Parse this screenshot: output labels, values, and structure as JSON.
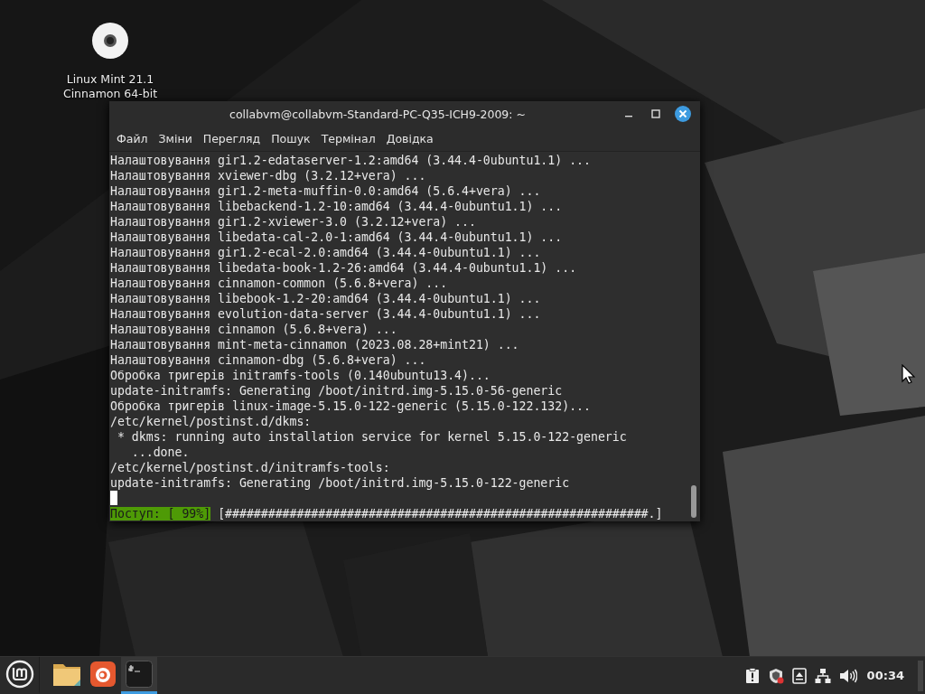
{
  "desktop": {
    "icons": [
      {
        "kind": "disc",
        "label": "Linux Mint 21.1 Cinnamon 64-bit"
      }
    ]
  },
  "window": {
    "title": "collabvm@collabvm-Standard-PC-Q35-ICH9-2009: ~",
    "menu": [
      "Файл",
      "Зміни",
      "Перегляд",
      "Пошук",
      "Термінал",
      "Довідка"
    ],
    "terminal": {
      "lines": [
        "Налаштовування gir1.2-edataserver-1.2:amd64 (3.44.4-0ubuntu1.1) ...",
        "Налаштовування xviewer-dbg (3.2.12+vera) ...",
        "Налаштовування gir1.2-meta-muffin-0.0:amd64 (5.6.4+vera) ...",
        "Налаштовування libebackend-1.2-10:amd64 (3.44.4-0ubuntu1.1) ...",
        "Налаштовування gir1.2-xviewer-3.0 (3.2.12+vera) ...",
        "Налаштовування libedata-cal-2.0-1:amd64 (3.44.4-0ubuntu1.1) ...",
        "Налаштовування gir1.2-ecal-2.0:amd64 (3.44.4-0ubuntu1.1) ...",
        "Налаштовування libedata-book-1.2-26:amd64 (3.44.4-0ubuntu1.1) ...",
        "Налаштовування cinnamon-common (5.6.8+vera) ...",
        "Налаштовування libebook-1.2-20:amd64 (3.44.4-0ubuntu1.1) ...",
        "Налаштовування evolution-data-server (3.44.4-0ubuntu1.1) ...",
        "Налаштовування cinnamon (5.6.8+vera) ...",
        "Налаштовування mint-meta-cinnamon (2023.08.28+mint21) ...",
        "Налаштовування cinnamon-dbg (5.6.8+vera) ...",
        "Обробка тригерів initramfs-tools (0.140ubuntu13.4)...",
        "update-initramfs: Generating /boot/initrd.img-5.15.0-56-generic",
        "Обробка тригерів linux-image-5.15.0-122-generic (5.15.0-122.132)...",
        "/etc/kernel/postinst.d/dkms:",
        " * dkms: running auto installation service for kernel 5.15.0-122-generic",
        "   ...done.",
        "/etc/kernel/postinst.d/initramfs-tools:",
        "update-initramfs: Generating /boot/initrd.img-5.15.0-122-generic"
      ],
      "progress": {
        "label": "Поступ: [ 99%]",
        "bar": "[###########################################################.]"
      }
    }
  },
  "taskbar": {
    "launchers": [
      {
        "kind": "menu",
        "selected": false
      },
      {
        "kind": "files",
        "selected": false
      },
      {
        "kind": "firefox",
        "selected": false
      },
      {
        "kind": "terminal",
        "selected": true
      }
    ],
    "tray": [
      {
        "kind": "update"
      },
      {
        "kind": "shield"
      },
      {
        "kind": "eject"
      },
      {
        "kind": "network"
      },
      {
        "kind": "volume"
      }
    ],
    "clock": "00:34"
  }
}
